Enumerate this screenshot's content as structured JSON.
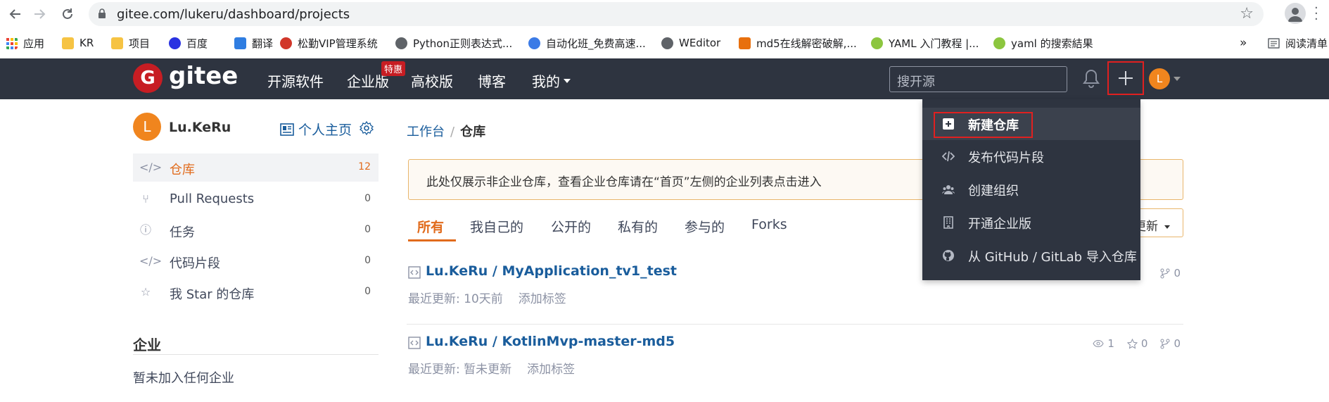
{
  "browser": {
    "url": "gitee.com/lukeru/dashboard/projects",
    "bookmarks": [
      {
        "label": "应用",
        "color": "#e94235"
      },
      {
        "label": "KR",
        "color": "#f6c343"
      },
      {
        "label": "项目",
        "color": "#f6c343"
      },
      {
        "label": "百度",
        "color": "#2932e1"
      },
      {
        "label": "翻译",
        "color": "#2f7de1"
      },
      {
        "label": "松勤VIP管理系统",
        "color": "#d1372a"
      },
      {
        "label": "Python正则表达式...",
        "color": "#5f6368"
      },
      {
        "label": "自动化班_免费高速...",
        "color": "#3c7be6"
      },
      {
        "label": "WEditor",
        "color": "#5f6368"
      },
      {
        "label": "md5在线解密破解,...",
        "color": "#e8700e"
      },
      {
        "label": "YAML 入门教程 |...",
        "color": "#8cc63f"
      },
      {
        "label": "yaml 的搜索結果",
        "color": "#8cc63f"
      }
    ],
    "more_bookmarks": "»",
    "reading_list": "阅读清单"
  },
  "header": {
    "logo_text": "gitee",
    "nav": [
      "开源软件",
      "企业版",
      "高校版",
      "博客",
      "我的"
    ],
    "badge": "特惠",
    "search_placeholder": "搜开源",
    "avatar_letter": "L"
  },
  "sidebar": {
    "avatar_letter": "L",
    "username": "Lu.KeRu",
    "homepage_label": "个人主页",
    "items": [
      {
        "label": "仓库",
        "count": "12"
      },
      {
        "label": "Pull Requests",
        "count": "0"
      },
      {
        "label": "任务",
        "count": "0"
      },
      {
        "label": "代码片段",
        "count": "0"
      },
      {
        "label": "我 Star 的仓库",
        "count": "0"
      }
    ],
    "enterprise_heading": "企业",
    "enterprise_empty": "暂未加入任何企业"
  },
  "main": {
    "breadcrumb_root": "工作台",
    "breadcrumb_sep": "/",
    "breadcrumb_current": "仓库",
    "notice": "此处仅展示非企业仓库，查看企业仓库请在“首页”左侧的企业列表点击进入",
    "tabs": [
      "所有",
      "我自己的",
      "公开的",
      "私有的",
      "参与的",
      "Forks"
    ],
    "sort_label": "更新",
    "repos": [
      {
        "owner": "Lu.KeRu",
        "name": "MyApplication_tv1_test",
        "updated": "最近更新: 10天前",
        "add_tag": "添加标签",
        "watch": "",
        "star": "",
        "fork": "0"
      },
      {
        "owner": "Lu.KeRu",
        "name": "KotlinMvp-master-md5",
        "updated": "最近更新: 暂未更新",
        "add_tag": "添加标签",
        "watch": "1",
        "star": "0",
        "fork": "0"
      }
    ]
  },
  "dropdown": {
    "items": [
      "新建仓库",
      "发布代码片段",
      "创建组织",
      "开通企业版",
      "从 GitHub / GitLab 导入仓库"
    ]
  }
}
